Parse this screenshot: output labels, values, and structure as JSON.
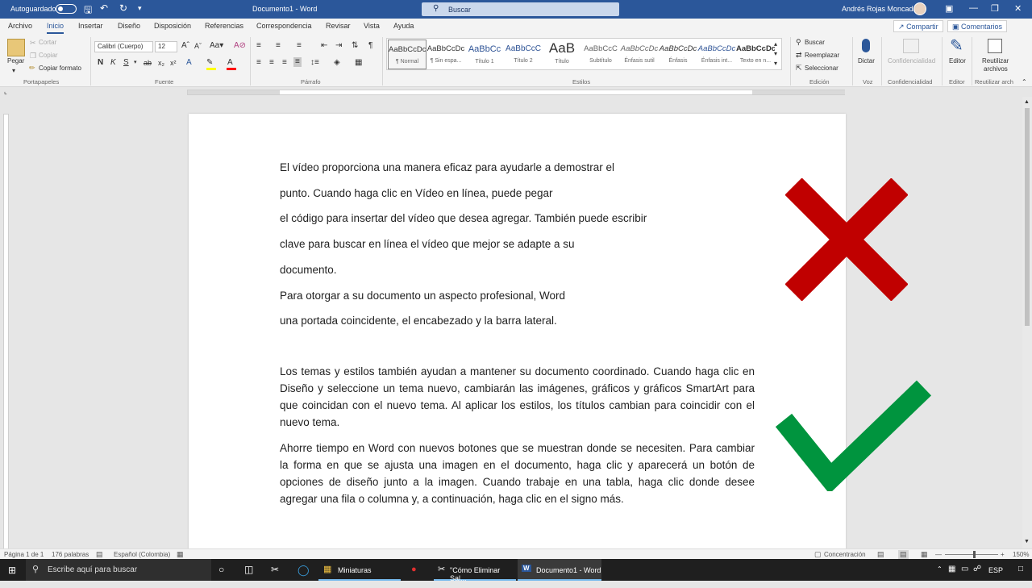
{
  "titlebar": {
    "autosave_label": "Autoguardado",
    "doc_title": "Documento1 - Word",
    "search_label": "Buscar",
    "user_name": "Andrés Rojas Moncada"
  },
  "tabs": [
    "Archivo",
    "Inicio",
    "Insertar",
    "Diseño",
    "Disposición",
    "Referencias",
    "Correspondencia",
    "Revisar",
    "Vista",
    "Ayuda"
  ],
  "share": {
    "share_label": "Compartir",
    "comments_label": "Comentarios"
  },
  "ribbon": {
    "clipboard": {
      "paste": "Pegar",
      "cut": "Cortar",
      "copy": "Copiar",
      "format_painter": "Copiar formato",
      "group": "Portapapeles"
    },
    "font": {
      "family": "Calibri (Cuerpo)",
      "size": "12",
      "group": "Fuente"
    },
    "paragraph": {
      "group": "Párrafo"
    },
    "styles": {
      "group": "Estilos",
      "items": [
        {
          "sample": "AaBbCcDc",
          "name": "¶ Normal"
        },
        {
          "sample": "AaBbCcDc",
          "name": "¶ Sin espa..."
        },
        {
          "sample": "AaBbCc",
          "name": "Título 1"
        },
        {
          "sample": "AaBbCcC",
          "name": "Título 2"
        },
        {
          "sample": "AaB",
          "name": "Título"
        },
        {
          "sample": "AaBbCcC",
          "name": "Subtítulo"
        },
        {
          "sample": "AaBbCcDc",
          "name": "Énfasis sutil"
        },
        {
          "sample": "AaBbCcDc",
          "name": "Énfasis"
        },
        {
          "sample": "AaBbCcDc",
          "name": "Énfasis int..."
        },
        {
          "sample": "AaBbCcDc",
          "name": "Texto en n..."
        }
      ]
    },
    "editing": {
      "find": "Buscar",
      "replace": "Reemplazar",
      "select": "Seleccionar",
      "group": "Edición"
    },
    "voice": {
      "dictate": "Dictar",
      "group": "Voz"
    },
    "sensitivity": {
      "label": "Confidencialidad",
      "group": "Confidencialidad"
    },
    "editor": {
      "label": "Editor",
      "group": "Editor"
    },
    "reuse": {
      "label1": "Reutilizar",
      "label2": "archivos",
      "group": "Reutilizar arch"
    }
  },
  "document": {
    "lines": [
      "El vídeo proporciona una manera eficaz para ayudarle a demostrar el",
      "punto. Cuando haga clic en Vídeo en línea, puede pegar",
      "el código para insertar del vídeo que desea agregar. También puede escribir",
      "clave para buscar en línea el vídeo que mejor se adapte a su",
      "documento.",
      "Para otorgar a su documento un aspecto profesional, Word",
      "una portada coincidente, el encabezado y la barra lateral."
    ],
    "para1": "Los temas y estilos también ayudan a mantener su documento coordinado. Cuando haga clic en Diseño y seleccione un tema nuevo, cambiarán las imágenes, gráficos y gráficos SmartArt para que coincidan con el nuevo tema. Al aplicar los estilos, los títulos cambian para coincidir con el nuevo tema.",
    "para2": "Ahorre tiempo en Word con nuevos botones que se muestran donde se necesiten. Para cambiar la forma en que se ajusta una imagen en el documento, haga clic y aparecerá un botón de opciones de diseño junto a la imagen. Cuando trabaje en una tabla, haga clic donde desee agregar una fila o columna y, a continuación, haga clic en el signo más.",
    "cross_color": "#c00000",
    "check_color": "#00943e"
  },
  "status": {
    "page": "Página 1 de 1",
    "words": "176 palabras",
    "language": "Español (Colombia)",
    "focus": "Concentración",
    "zoom": "150%"
  },
  "taskbar": {
    "search_placeholder": "Escribe aquí para buscar",
    "apps": [
      "Miniaturas",
      "\"Cómo Eliminar Sal...",
      "Documento1 - Word"
    ],
    "lang": "ESP"
  }
}
